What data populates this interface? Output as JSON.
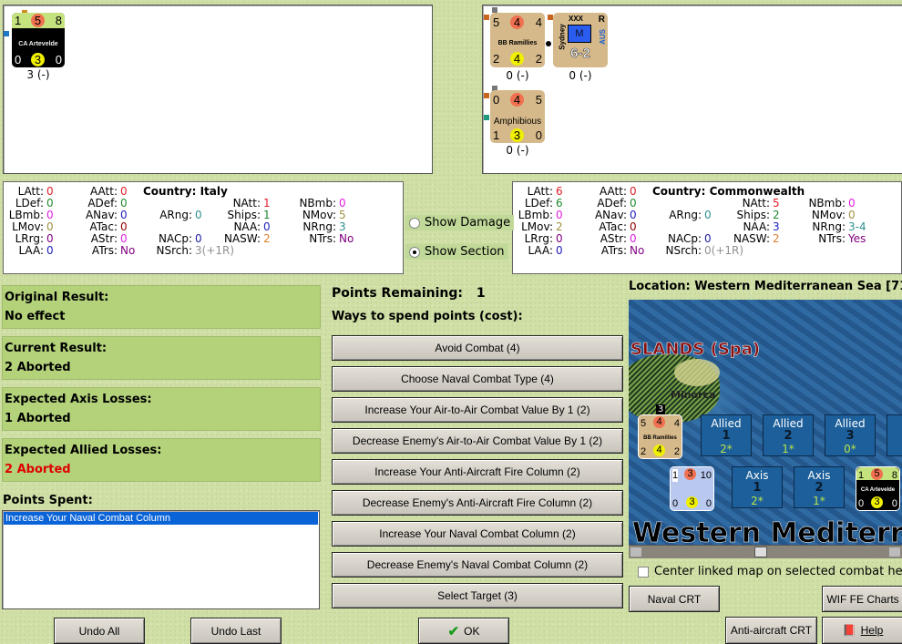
{
  "axis_counters": {
    "ca_artevelde": {
      "top": [
        "1",
        "5",
        "8"
      ],
      "name": "CA Artevelde",
      "bottom": [
        "0",
        "3",
        "0"
      ],
      "label": "3 (-)"
    }
  },
  "allied_counters": {
    "bb_ramillies": {
      "top": [
        "5",
        "4",
        "4"
      ],
      "name": "BB Ramillies",
      "bottom": [
        "2",
        "4",
        "2"
      ],
      "label": "0 (-)"
    },
    "sydney": {
      "size": "XXX",
      "side": "R",
      "name": "Sydney",
      "country": "AUS",
      "type": "M",
      "strength": "6-2",
      "label": "0 (-)"
    },
    "amphibious": {
      "top": [
        "0",
        "4",
        "5"
      ],
      "name": "Amphibious",
      "bottom": [
        "1",
        "3",
        "0"
      ],
      "label": "0 (-)"
    }
  },
  "axis_stats": {
    "country_label": "Country: Italy",
    "LAtt": "0",
    "AAtt": "0",
    "LDef": "0",
    "ADef": "0",
    "NAtt": "1",
    "NBmb": "0",
    "LBmb": "0",
    "ANav": "0",
    "ARng": "0",
    "Ships": "1",
    "NMov": "5",
    "LMov": "0",
    "ATac": "0",
    "NAA": "0",
    "NRng": "3",
    "LRrg": "0",
    "AStr": "0",
    "NACp": "0",
    "NASW": "2",
    "NTrs": "No",
    "LAA": "0",
    "ATrs": "No",
    "NSrch": "3(+1R)"
  },
  "allied_stats": {
    "country_label": "Country: Commonwealth",
    "LAtt": "6",
    "AAtt": "0",
    "LDef": "6",
    "ADef": "0",
    "NAtt": "5",
    "NBmb": "0",
    "LBmb": "0",
    "ANav": "0",
    "ARng": "0",
    "Ships": "2",
    "NMov": "0",
    "LMov": "2",
    "ATac": "0",
    "NAA": "3",
    "NRng": "3-4",
    "LRrg": "0",
    "AStr": "0",
    "NACp": "0",
    "NASW": "2",
    "NTrs": "Yes",
    "LAA": "0",
    "ATrs": "No",
    "NSrch": "0(+1R)"
  },
  "stat_colors": {
    "LAtt": "#e0202a",
    "AAtt": "#e0202a",
    "NAtt": "#e0202a",
    "LDef": "#208a30",
    "ADef": "#208a30",
    "Ships": "#208a30",
    "LBmb": "#e020e0",
    "NBmb": "#e020e0",
    "AStr": "#e020e0",
    "LMov": "#a09040",
    "NMov": "#a09040",
    "LRrg": "#800080",
    "NTrs": "#800080",
    "ATrs": "#800080",
    "LAA": "#2020c0",
    "ANav": "#2020c0",
    "NAA": "#2020c0",
    "NACp": "#2020a0",
    "ARng": "#309090",
    "NRng": "#309090",
    "ATac": "#900000",
    "NASW": "#e08030",
    "NSrch": "#909090"
  },
  "options": {
    "show_damage": "Show Damage",
    "show_section": "Show Section",
    "selected": "show_section"
  },
  "results": [
    {
      "title": "Original Result:",
      "value": "No effect",
      "color": "#000000"
    },
    {
      "title": "Current Result:",
      "value": "2 Aborted",
      "color": "#000000"
    },
    {
      "title": "Expected Axis Losses:",
      "value": "1 Aborted",
      "color": "#000000"
    },
    {
      "title": "Expected Allied Losses:",
      "value": "2 Aborted",
      "color": "#e00000"
    }
  ],
  "points_spent": {
    "title": "Points Spent:",
    "items": [
      "Increase Your Naval Combat Column"
    ]
  },
  "points_remaining": {
    "label": "Points Remaining:",
    "value": "1"
  },
  "ways_title": "Ways to spend points (cost):",
  "ways": [
    "Avoid Combat (4)",
    "Choose Naval Combat Type (4)",
    "Increase Your Air-to-Air Combat Value By 1 (2)",
    "Decrease Enemy's Air-to-Air Combat Value By 1 (2)",
    "Increase Your Anti-Aircraft Fire Column (2)",
    "Decrease Enemy's Anti-Aircraft Fire Column (2)",
    "Increase Your Naval Combat Column (2)",
    "Decrease Enemy's Naval Combat Column (2)",
    "Select Target (3)"
  ],
  "map": {
    "location": "Location: Western Mediterranean Sea [71",
    "region_label": "SLANDS (Spa)",
    "island": "Minorca",
    "sea_label": "Western Mediterran",
    "stack_count": "3",
    "allied_boxes": [
      {
        "t": "Allied",
        "n": "1",
        "v": "2*"
      },
      {
        "t": "Allied",
        "n": "2",
        "v": "1*"
      },
      {
        "t": "Allied",
        "n": "3",
        "v": "0*"
      }
    ],
    "axis_boxes": [
      {
        "t": "Axis",
        "n": "1",
        "v": "2*"
      },
      {
        "t": "Axis",
        "n": "2",
        "v": "1*"
      }
    ],
    "map_bb": {
      "top": [
        "5",
        "4",
        "4"
      ],
      "name": "BB Ramillies",
      "bottom": [
        "2",
        "4",
        "2"
      ]
    },
    "map_group": {
      "top": [
        "1",
        "3",
        "10"
      ],
      "bottom": [
        "0",
        "3",
        "0"
      ]
    },
    "map_ca": {
      "top": [
        "1",
        "5",
        "8"
      ],
      "name": "CA Artevelde",
      "bottom": [
        "0",
        "3",
        "0"
      ]
    },
    "center_checkbox": "Center linked map on selected combat he"
  },
  "buttons": {
    "undo_all": "Undo All",
    "undo_last": "Undo Last",
    "ok": "OK",
    "naval_crt": "Naval CRT",
    "wif_charts": "WIF FE Charts",
    "aa_crt": "Anti-aircraft CRT",
    "help": "Help"
  }
}
